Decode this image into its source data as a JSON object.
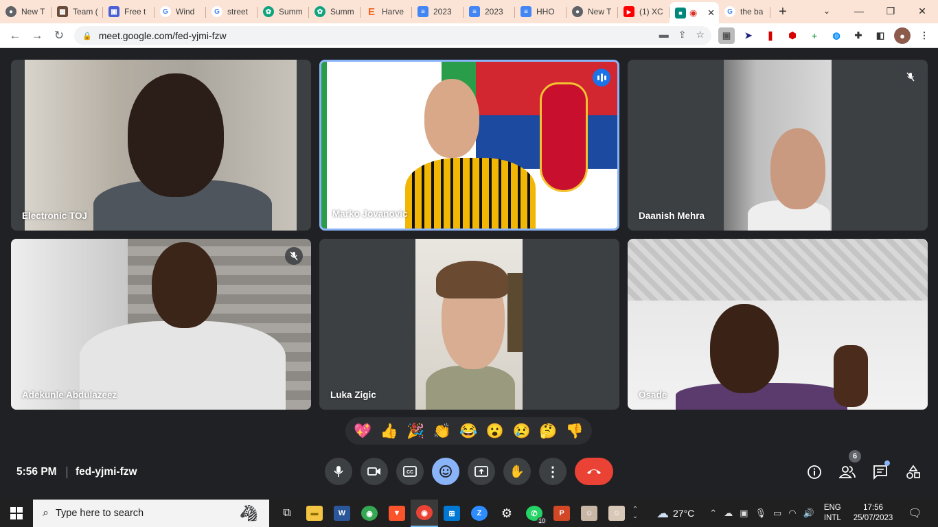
{
  "browser": {
    "tabs": [
      {
        "title": "New T",
        "icon": "chrome-icon",
        "color": "#5f6368"
      },
      {
        "title": "Team (",
        "icon": "team-icon",
        "color": "#6b4c3b"
      },
      {
        "title": "Free t",
        "icon": "free-icon",
        "color": "#4b5fd6"
      },
      {
        "title": "Wind",
        "icon": "google-icon",
        "color": "#4285f4"
      },
      {
        "title": "street",
        "icon": "google-icon",
        "color": "#4285f4"
      },
      {
        "title": "Summ",
        "icon": "openai-icon",
        "color": "#10a37f"
      },
      {
        "title": "Summ",
        "icon": "openai-icon",
        "color": "#10a37f"
      },
      {
        "title": "Harve",
        "icon": "etsy-icon",
        "color": "#f1641e"
      },
      {
        "title": "2023",
        "icon": "docs-icon",
        "color": "#4285f4"
      },
      {
        "title": "2023",
        "icon": "docs-icon",
        "color": "#4285f4"
      },
      {
        "title": "HHO",
        "icon": "docs-icon",
        "color": "#4285f4"
      },
      {
        "title": "New T",
        "icon": "chrome-icon",
        "color": "#5f6368"
      },
      {
        "title": "(1) XC",
        "icon": "youtube-icon",
        "color": "#ff0000"
      },
      {
        "title": "",
        "icon": "meet-icon",
        "color": "#00897b"
      },
      {
        "title": "the ba",
        "icon": "google-icon",
        "color": "#4285f4"
      }
    ],
    "url": "meet.google.com/fed-yjmi-fzw"
  },
  "meeting": {
    "participants": [
      {
        "name": "Electronic TOJ",
        "muted": false,
        "speaking": false
      },
      {
        "name": "Marko Jovanovic",
        "muted": false,
        "speaking": true
      },
      {
        "name": "Daanish Mehra",
        "muted": true,
        "speaking": false
      },
      {
        "name": "Adekunle Abdulazeez",
        "muted": true,
        "speaking": false
      },
      {
        "name": "Luka Zigic",
        "muted": false,
        "speaking": false
      },
      {
        "name": "Osade",
        "muted": false,
        "speaking": false
      }
    ],
    "reactions": [
      "💖",
      "👍",
      "🎉",
      "👏",
      "😂",
      "😮",
      "😢",
      "🤔",
      "👎"
    ],
    "time": "5:56 PM",
    "code": "fed-yjmi-fzw",
    "participant_count": "6",
    "accent": "#8ab4f8",
    "leave_color": "#ea4335"
  },
  "taskbar": {
    "search_placeholder": "Type here to search",
    "weather": "27°C",
    "lang_line1": "ENG",
    "lang_line2": "INTL",
    "clock_time": "17:56",
    "clock_date": "25/07/2023",
    "whatsapp_badge": "10"
  }
}
